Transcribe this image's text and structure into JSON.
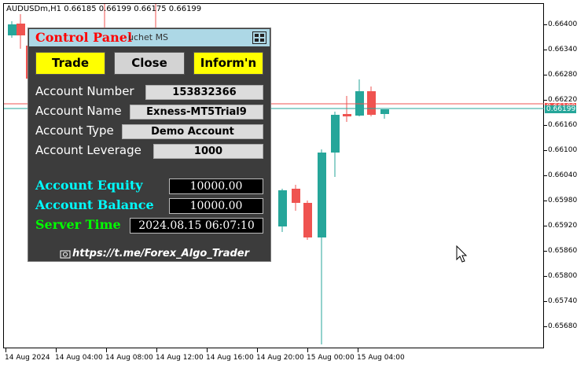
{
  "chart": {
    "symbol_info": "AUDUSDm,H1  0.66185 0.66199 0.66175 0.66199",
    "price_levels": [
      "0.66400",
      "0.66340",
      "0.66280",
      "0.66220",
      "0.66160",
      "0.66100",
      "0.66040",
      "0.65980",
      "0.65920",
      "0.65860",
      "0.65800",
      "0.65740",
      "0.65680"
    ],
    "time_labels": [
      "14 Aug 2024",
      "14 Aug 04:00",
      "14 Aug 08:00",
      "14 Aug 12:00",
      "14 Aug 16:00",
      "14 Aug 20:00",
      "15 Aug 00:00",
      "15 Aug 04:00"
    ],
    "bid_price": "0.66199",
    "ask_price": "0.66199",
    "colors": {
      "bull": "#26a69a",
      "bear": "#ef5350",
      "bid_line": "#26a69a",
      "ask_line": "#ef5350"
    }
  },
  "panel": {
    "title": "Control Panel",
    "subtitle": "uchet MS",
    "icon": "windows-logo-icon",
    "buttons": {
      "trade": "Trade",
      "close": "Close",
      "inform": "Inform'n"
    },
    "account": {
      "number_label": "Account Number",
      "number": "153832366",
      "name_label": "Account Name",
      "name": "Exness-MT5Trial9",
      "type_label": "Account Type",
      "type": "Demo Account",
      "leverage_label": "Account Leverage",
      "leverage": "1000"
    },
    "finance": {
      "equity_label": "Account Equity",
      "equity": "10000.00",
      "balance_label": "Account Balance",
      "balance": "10000.00",
      "server_time_label": "Server Time",
      "server_time": "2024.08.15 06:07:10"
    },
    "link": "https://t.me/Forex_Algo_Trader",
    "colors": {
      "title": "#ff0000",
      "equity_balance": "#00ffff",
      "server_time": "#00ff00",
      "titlebar": "#add8e6"
    }
  }
}
